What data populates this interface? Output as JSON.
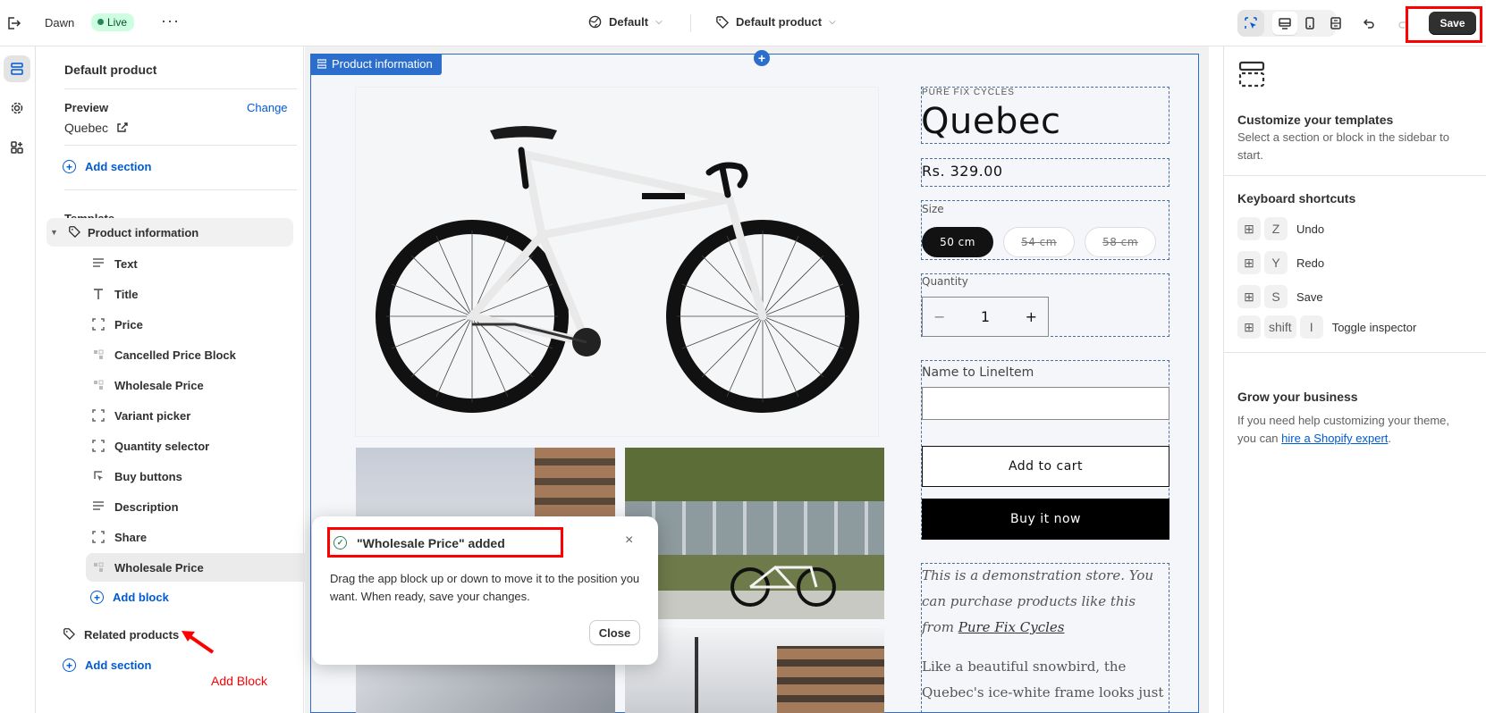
{
  "topbar": {
    "theme_name": "Dawn",
    "live_badge": "Live",
    "more_label": "···",
    "template_select": "Default",
    "product_select": "Default product",
    "save_label": "Save"
  },
  "sidebar": {
    "title": "Default product",
    "preview_label": "Preview",
    "change_label": "Change",
    "preview_value": "Quebec",
    "add_section_top": "Add section",
    "template_label": "Template",
    "section_label": "Product information",
    "blocks": [
      {
        "label": "Text",
        "icon": "text-icon"
      },
      {
        "label": "Title",
        "icon": "title-icon"
      },
      {
        "label": "Price",
        "icon": "block-icon"
      },
      {
        "label": "Cancelled Price Block",
        "icon": "app-block-icon"
      },
      {
        "label": "Wholesale Price",
        "icon": "app-block-icon"
      },
      {
        "label": "Variant picker",
        "icon": "block-icon"
      },
      {
        "label": "Quantity selector",
        "icon": "block-icon"
      },
      {
        "label": "Buy buttons",
        "icon": "cursor-icon"
      },
      {
        "label": "Description",
        "icon": "text-icon"
      },
      {
        "label": "Share",
        "icon": "block-icon"
      },
      {
        "label": "Wholesale Price",
        "icon": "app-block-icon",
        "selected": true
      }
    ],
    "add_block": "Add block",
    "related_products": "Related products",
    "add_section_bottom": "Add section"
  },
  "annotation": {
    "add_block_note": "Add Block"
  },
  "canvas": {
    "section_tab": "Product information",
    "vendor": "PURE FIX CYCLES",
    "product_title": "Quebec",
    "price": "Rs. 329.00",
    "size_label": "Size",
    "sizes": [
      {
        "label": "50 cm",
        "selected": true
      },
      {
        "label": "54 cm",
        "selected": false
      },
      {
        "label": "58 cm",
        "selected": false
      }
    ],
    "quantity_label": "Quantity",
    "quantity_minus": "−",
    "quantity_value": "1",
    "quantity_plus": "+",
    "name_to_lineitem": "Name to LineItem",
    "add_to_cart": "Add to cart",
    "buy_it_now": "Buy it now",
    "desc_italic": "This is a demonstration store. You can purchase products like this from ",
    "desc_link": "Pure Fix Cycles",
    "desc_second": "Like a beautiful snowbird, the Quebec's ice-white frame looks just as"
  },
  "toast": {
    "title": "\"Wholesale Price\" added",
    "body": "Drag the app block up or down to move it to the position you want. When ready, save your changes.",
    "close_label": "Close",
    "x_label": "×"
  },
  "right_panel": {
    "customize_title": "Customize your templates",
    "customize_text": "Select a section or block in the sidebar to start.",
    "shortcuts_title": "Keyboard shortcuts",
    "shortcuts": [
      {
        "keys": [
          "⊞",
          "Z"
        ],
        "label": "Undo"
      },
      {
        "keys": [
          "⊞",
          "Y"
        ],
        "label": "Redo"
      },
      {
        "keys": [
          "⊞",
          "S"
        ],
        "label": "Save"
      },
      {
        "keys": [
          "⊞",
          "shift",
          "I"
        ],
        "label": "Toggle inspector"
      }
    ],
    "grow_title": "Grow your business",
    "grow_text_1": "If you need help customizing your theme, you can ",
    "grow_link": "hire a Shopify expert",
    "grow_text_2": "."
  },
  "colors": {
    "accent": "#005bd3",
    "selection_blue": "#2c6ecb",
    "annotation_red": "#ff0000",
    "live_bg": "#cdfee1"
  }
}
